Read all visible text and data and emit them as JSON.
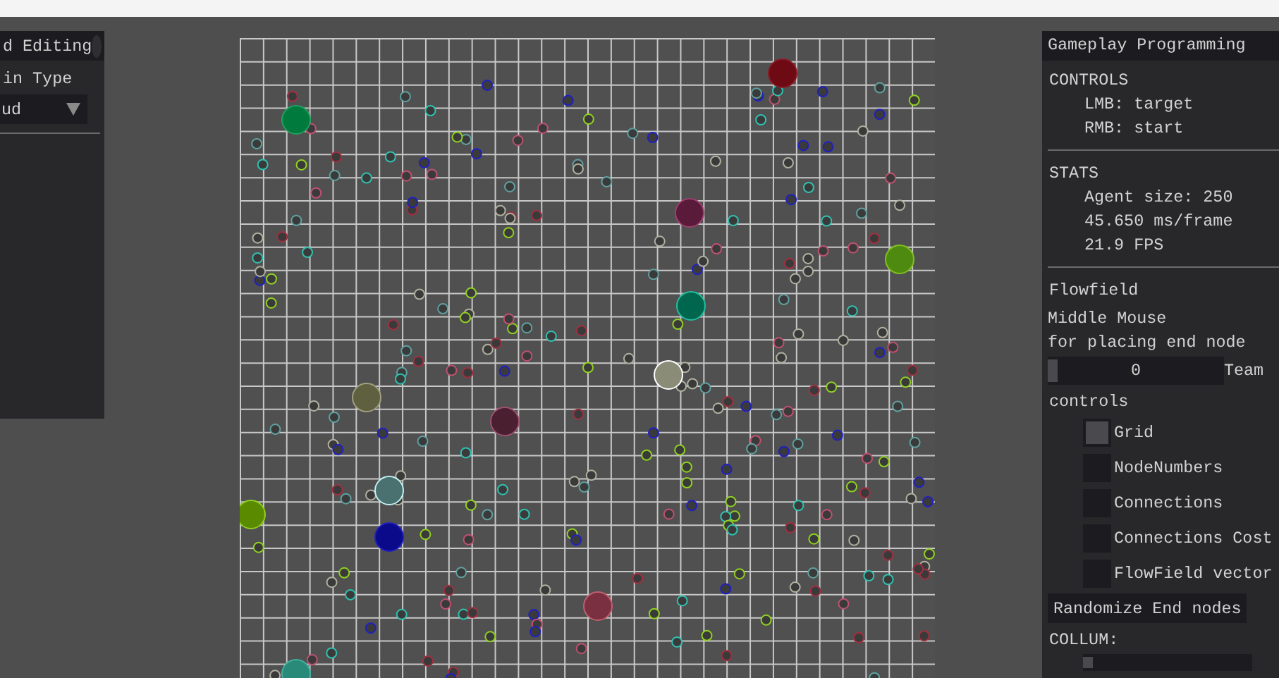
{
  "left_panel": {
    "title": "d Editing",
    "field_label": "in Type",
    "dropdown": {
      "value": "ud"
    }
  },
  "right_panel": {
    "title": "Gameplay Programming",
    "sections": [
      {
        "heading": "CONTROLS",
        "lines": [
          "LMB: target",
          "RMB: start"
        ]
      },
      {
        "heading": "STATS",
        "lines": [
          "Agent size: 250",
          "45.650 ms/frame",
          "21.9 FPS"
        ]
      }
    ],
    "flowfield": {
      "heading": "Flowfield",
      "hint_lines": [
        "Middle Mouse",
        "for placing end node"
      ],
      "team_slider": {
        "value": "0",
        "level": 0,
        "label": "Team"
      }
    },
    "controls": {
      "heading": "controls",
      "checkboxes": [
        {
          "label": "Grid",
          "checked": true
        },
        {
          "label": "NodeNumbers",
          "checked": false
        },
        {
          "label": "Connections",
          "checked": false
        },
        {
          "label": "Connections Cost",
          "checked": false
        },
        {
          "label": "FlowField vector",
          "checked": false
        }
      ]
    },
    "randomize_button": "Randomize End nodes",
    "collum": {
      "label": "COLLUM:",
      "slider": {
        "level": 0
      }
    }
  }
}
